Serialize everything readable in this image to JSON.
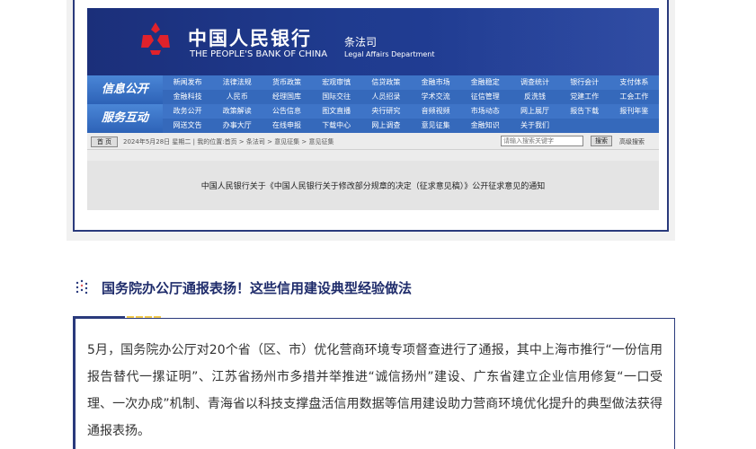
{
  "pboc": {
    "logo_cn": "中国人民银行",
    "logo_en": "THE PEOPLE'S BANK OF CHINA",
    "dept_cn": "条法司",
    "dept_en": "Legal Affairs Department",
    "side_labels": [
      "信息公开",
      "服务互动"
    ],
    "nav_rows": [
      [
        "新闻发布",
        "法律法规",
        "货币政策",
        "宏观审慎",
        "信贷政策",
        "金融市场",
        "金融稳定",
        "调查统计",
        "银行会计",
        "支付体系"
      ],
      [
        "金融科技",
        "人民币",
        "经理国库",
        "国际交往",
        "人员招录",
        "学术交流",
        "征信管理",
        "反洗钱",
        "党建工作",
        "工会工作"
      ],
      [
        "政务公开",
        "政策解读",
        "公告信息",
        "图文直播",
        "央行研究",
        "音频视频",
        "市场动态",
        "网上展厅",
        "报告下载",
        "报刊年鉴"
      ],
      [
        "网送文告",
        "办事大厅",
        "在线申报",
        "下载中心",
        "网上调查",
        "意见征集",
        "金融知识",
        "关于我们",
        "",
        ""
      ]
    ],
    "home_label": "首 页",
    "breadcrumb": "2024年5月28日 星期二 | 我的位置:首页 > 条法司 > 意见征集 > 意见征集",
    "search_placeholder": "请输入搜索关键字",
    "search_button": "搜索",
    "advanced_search": "高级搜索",
    "notice": "中国人民银行关于《中国人民银行关于修改部分规章的决定（征求意见稿）》公开征求意见的通知"
  },
  "section": {
    "title": "国务院办公厅通报表扬！这些信用建设典型经验做法"
  },
  "article": {
    "paragraph": "5月，国务院办公厅对20个省（区、市）优化营商环境专项督查进行了通报，其中上海市推行“一份信用报告替代一摞证明”、江苏省扬州市多措并举推进“诚信扬州”建设、广东省建立企业信用修复“一口受理、一次办成”机制、青海省以科技支撑盘活信用数据等信用建设助力营商环境优化提升的典型做法获得通报表扬。"
  },
  "colors": {
    "brand_navy": "#2a3a7c",
    "title_navy": "#1f2c6b",
    "accent_yellow": "#f2c94c",
    "nav_blue": "#3569bb"
  }
}
